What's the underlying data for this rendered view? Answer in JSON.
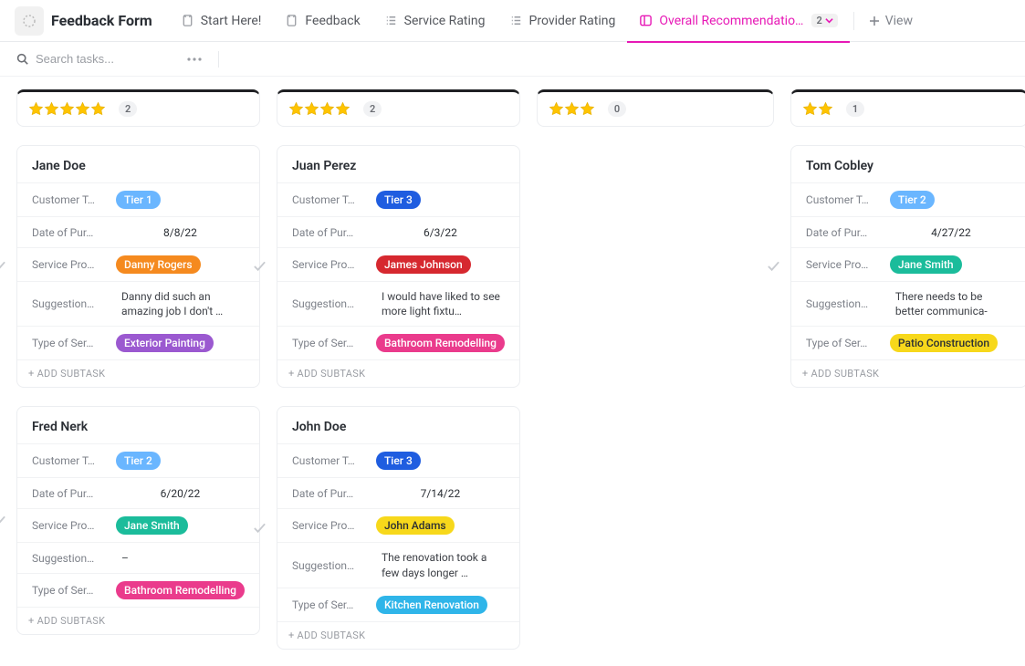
{
  "header": {
    "title": "Feedback Form",
    "tabs": [
      {
        "label": "Start Here!",
        "icon": "doc"
      },
      {
        "label": "Feedback",
        "icon": "doc"
      },
      {
        "label": "Service Rating",
        "icon": "list"
      },
      {
        "label": "Provider Rating",
        "icon": "list"
      },
      {
        "label": "Overall Recommendatio…",
        "icon": "board",
        "active": true,
        "count": "2"
      }
    ],
    "add_view_label": "View"
  },
  "toolbar": {
    "search_placeholder": "Search tasks..."
  },
  "columns": [
    {
      "stars": 5,
      "count": "2",
      "cards": [
        {
          "name": "Jane Doe",
          "tier": {
            "label": "Tier 1",
            "bg": "#6ab6ff",
            "fg": "#ffffff"
          },
          "date": "8/8/22",
          "provider": {
            "label": "Danny Rogers",
            "bg": "#f58a1f",
            "fg": "#ffffff"
          },
          "suggestion": "Danny did such an amazing job I don't …",
          "service": {
            "label": "Exterior Painting",
            "bg": "#9b59d0",
            "fg": "#ffffff"
          }
        },
        {
          "name": "Fred Nerk",
          "tier": {
            "label": "Tier 2",
            "bg": "#6ab6ff",
            "fg": "#ffffff"
          },
          "date": "6/20/22",
          "provider": {
            "label": "Jane Smith",
            "bg": "#1bbc9b",
            "fg": "#ffffff"
          },
          "suggestion": "–",
          "service": {
            "label": "Bathroom Remodelling",
            "bg": "#ea3b8c",
            "fg": "#ffffff"
          }
        }
      ]
    },
    {
      "stars": 4,
      "count": "2",
      "cards": [
        {
          "name": "Juan Perez",
          "tier": {
            "label": "Tier 3",
            "bg": "#1f5de0",
            "fg": "#ffffff"
          },
          "date": "6/3/22",
          "provider": {
            "label": "James Johnson",
            "bg": "#d6282f",
            "fg": "#ffffff"
          },
          "suggestion": "I would have liked to see more light fixtu…",
          "service": {
            "label": "Bathroom Remodelling",
            "bg": "#ea3b8c",
            "fg": "#ffffff"
          }
        },
        {
          "name": "John Doe",
          "tier": {
            "label": "Tier 3",
            "bg": "#1f5de0",
            "fg": "#ffffff"
          },
          "date": "7/14/22",
          "provider": {
            "label": "John Adams",
            "bg": "#f7d81b",
            "fg": "#2a2e34"
          },
          "suggestion": "The renovation took a few days longer …",
          "service": {
            "label": "Kitchen Renovation",
            "bg": "#2fb5e9",
            "fg": "#ffffff"
          }
        }
      ]
    },
    {
      "stars": 3,
      "count": "0",
      "cards": []
    },
    {
      "stars": 2,
      "count": "1",
      "cards": [
        {
          "name": "Tom Cobley",
          "tier": {
            "label": "Tier 2",
            "bg": "#6ab6ff",
            "fg": "#ffffff"
          },
          "date": "4/27/22",
          "provider": {
            "label": "Jane Smith",
            "bg": "#1bbc9b",
            "fg": "#ffffff"
          },
          "suggestion": "There needs to be better communica-",
          "service": {
            "label": "Patio Construction",
            "bg": "#f7d81b",
            "fg": "#2a2e34"
          }
        }
      ]
    }
  ],
  "field_labels": {
    "tier": "Customer T…",
    "date": "Date of Pur…",
    "provider": "Service Pro…",
    "suggestion": "Suggestion…",
    "suggestion_short": "Suggestion…",
    "service": "Type of Ser…"
  },
  "misc": {
    "add_subtask": "+ ADD SUBTASK"
  }
}
